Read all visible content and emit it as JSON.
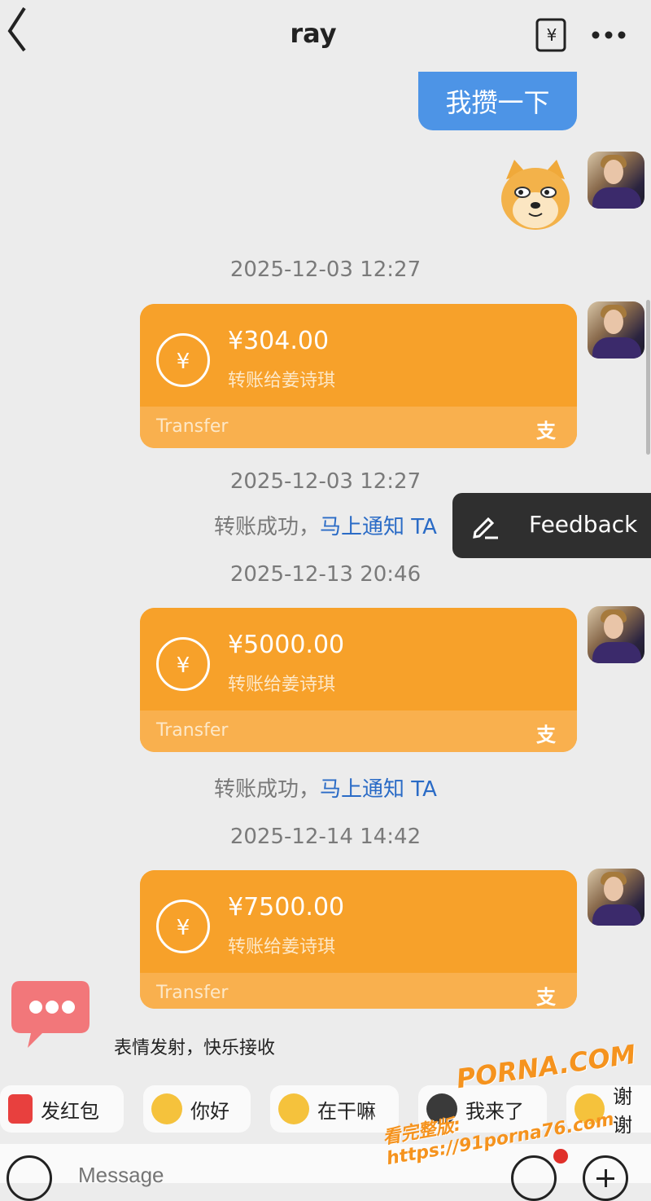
{
  "header": {
    "title": "ray",
    "back_icon": "chevron-left-icon",
    "exchange_icon": "yen-exchange-icon",
    "more_icon": "more-dots-icon"
  },
  "messages": {
    "outgoing_text": "我攒一下",
    "sticker": "doge-emoji-sticker"
  },
  "transfers": [
    {
      "timestamp": "2025-12-03 12:27",
      "amount": "¥304.00",
      "recipient": "转账给姜诗琪",
      "label": "Transfer",
      "logo": "支"
    },
    {
      "timestamp": "2025-12-13 20:46",
      "amount": "¥5000.00",
      "recipient": "转账给姜诗琪",
      "label": "Transfer",
      "logo": "支"
    },
    {
      "timestamp": "2025-12-14 14:42",
      "amount": "¥7500.00",
      "recipient": "转账给姜诗琪",
      "label": "Transfer",
      "logo": "支"
    }
  ],
  "notices": [
    {
      "timestamp": "2025-12-03 12:27",
      "text": "转账成功，",
      "link": "马上通知 TA"
    },
    {
      "text": "转账成功，",
      "link": "马上通知 TA"
    }
  ],
  "feedback": {
    "label": "Feedback",
    "icon": "edit-pen-icon"
  },
  "emoji_prompt": "表情发射，快乐接收",
  "quick_chips": [
    {
      "label": "发红包",
      "icon": "red-envelope-icon"
    },
    {
      "label": "你好",
      "icon": "wave-emoji-icon"
    },
    {
      "label": "在干嘛",
      "icon": "curious-emoji-icon"
    },
    {
      "label": "我来了",
      "icon": "running-emoji-icon"
    },
    {
      "label": "谢谢",
      "icon": "thanks-emoji-icon"
    }
  ],
  "input": {
    "placeholder": "Message"
  },
  "watermark": {
    "line1": "PORNA.COM",
    "line2": "看完整版: https://91porna76.com"
  },
  "colors": {
    "bubble": "#4d94e6",
    "transfer": "#f7a12a",
    "link": "#2a6bc6"
  }
}
